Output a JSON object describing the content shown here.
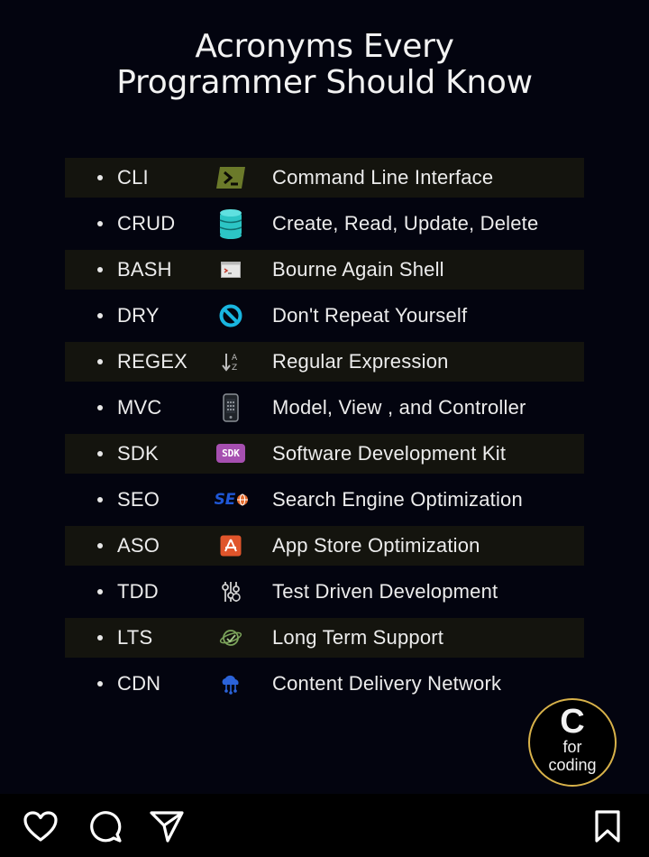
{
  "post": {
    "title_line1": "Acronyms Every",
    "title_line2": "Programmer Should Know",
    "items": [
      {
        "abbr": "CLI",
        "full": "Command Line Interface",
        "icon": "terminal-prompt-icon"
      },
      {
        "abbr": "CRUD",
        "full": "Create, Read, Update, Delete",
        "icon": "database-icon"
      },
      {
        "abbr": "BASH",
        "full": "Bourne Again Shell",
        "icon": "shell-window-icon"
      },
      {
        "abbr": "DRY",
        "full": "Don't Repeat Yourself",
        "icon": "no-entry-icon"
      },
      {
        "abbr": "REGEX",
        "full": "Regular Expression",
        "icon": "sort-az-icon"
      },
      {
        "abbr": "MVC",
        "full": "Model, View , and Controller",
        "icon": "mobile-device-icon"
      },
      {
        "abbr": "SDK",
        "full": "Software Development Kit",
        "icon": "sdk-badge-icon",
        "icon_text": "SDK"
      },
      {
        "abbr": "SEO",
        "full": "Search Engine Optimization",
        "icon": "seo-logo-icon",
        "icon_text": "SE"
      },
      {
        "abbr": "ASO",
        "full": "App Store Optimization",
        "icon": "app-store-icon"
      },
      {
        "abbr": "TDD",
        "full": "Test Driven Development",
        "icon": "settings-sliders-icon"
      },
      {
        "abbr": "LTS",
        "full": "Long Term Support",
        "icon": "support-globe-icon"
      },
      {
        "abbr": "CDN",
        "full": "Content Delivery Network",
        "icon": "cloud-network-icon"
      }
    ],
    "badge": {
      "big": "C",
      "line1": "for",
      "line2": "coding"
    }
  },
  "colors": {
    "background": "#03040f",
    "row_shade": "#14140e",
    "text": "#ececec",
    "badge_ring": "#d8b24a",
    "cli_icon": "#6b7a2a",
    "crud_icon": "#2cc5c5",
    "dry_icon": "#19b6e0",
    "sdk_icon": "#a64fb0",
    "seo_icon": "#1f57d6",
    "aso_icon": "#e0552b",
    "cdn_icon": "#2b63d9"
  },
  "actions": {
    "like": "heart-icon",
    "comment": "comment-icon",
    "share": "send-icon",
    "save": "bookmark-icon"
  }
}
